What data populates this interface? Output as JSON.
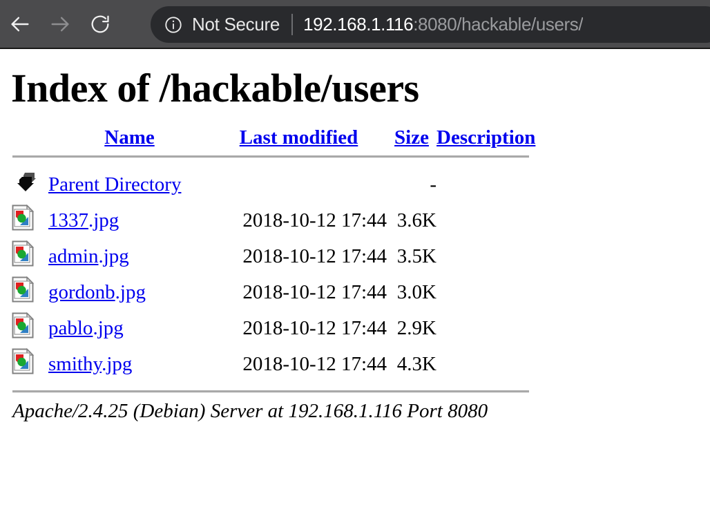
{
  "browser": {
    "back_icon": "arrow-left-icon",
    "forward_icon": "arrow-right-icon",
    "reload_icon": "reload-icon",
    "info_icon": "info-circle-icon",
    "security_label": "Not Secure",
    "url_host": "192.168.1.116",
    "url_rest": ":8080/hackable/users/",
    "url_full": "192.168.1.116:8080/hackable/users/",
    "toolbar_bg": "#4b4b4d",
    "pill_bg": "#292a2d"
  },
  "page": {
    "title": "Index of /hackable/users",
    "link_color": "#0000ee",
    "rule_color": "#a9a9a9",
    "columns": [
      {
        "label": "Name",
        "key": "name"
      },
      {
        "label": "Last modified",
        "key": "last_modified"
      },
      {
        "label": "Size",
        "key": "size"
      },
      {
        "label": "Description",
        "key": "description"
      }
    ],
    "parent": {
      "icon": "back-arrow-icon",
      "label": "Parent Directory",
      "last_modified": "",
      "size": "-",
      "description": ""
    },
    "rows": [
      {
        "icon": "image-file-icon",
        "stem": "1337",
        "ext": ".jpg",
        "name": "1337.jpg",
        "last_modified": "2018-10-12 17:44",
        "size": "3.6K",
        "description": ""
      },
      {
        "icon": "image-file-icon",
        "stem": "admin",
        "ext": ".jpg",
        "name": "admin.jpg",
        "last_modified": "2018-10-12 17:44",
        "size": "3.5K",
        "description": ""
      },
      {
        "icon": "image-file-icon",
        "stem": "gordonb",
        "ext": ".jpg",
        "name": "gordonb.jpg",
        "last_modified": "2018-10-12 17:44",
        "size": "3.0K",
        "description": ""
      },
      {
        "icon": "image-file-icon",
        "stem": "pablo",
        "ext": ".jpg",
        "name": "pablo.jpg",
        "last_modified": "2018-10-12 17:44",
        "size": "2.9K",
        "description": ""
      },
      {
        "icon": "image-file-icon",
        "stem": "smithy",
        "ext": ".jpg",
        "name": "smithy.jpg",
        "last_modified": "2018-10-12 17:44",
        "size": "4.3K",
        "description": ""
      }
    ],
    "footer": "Apache/2.4.25 (Debian) Server at 192.168.1.116 Port 8080"
  }
}
